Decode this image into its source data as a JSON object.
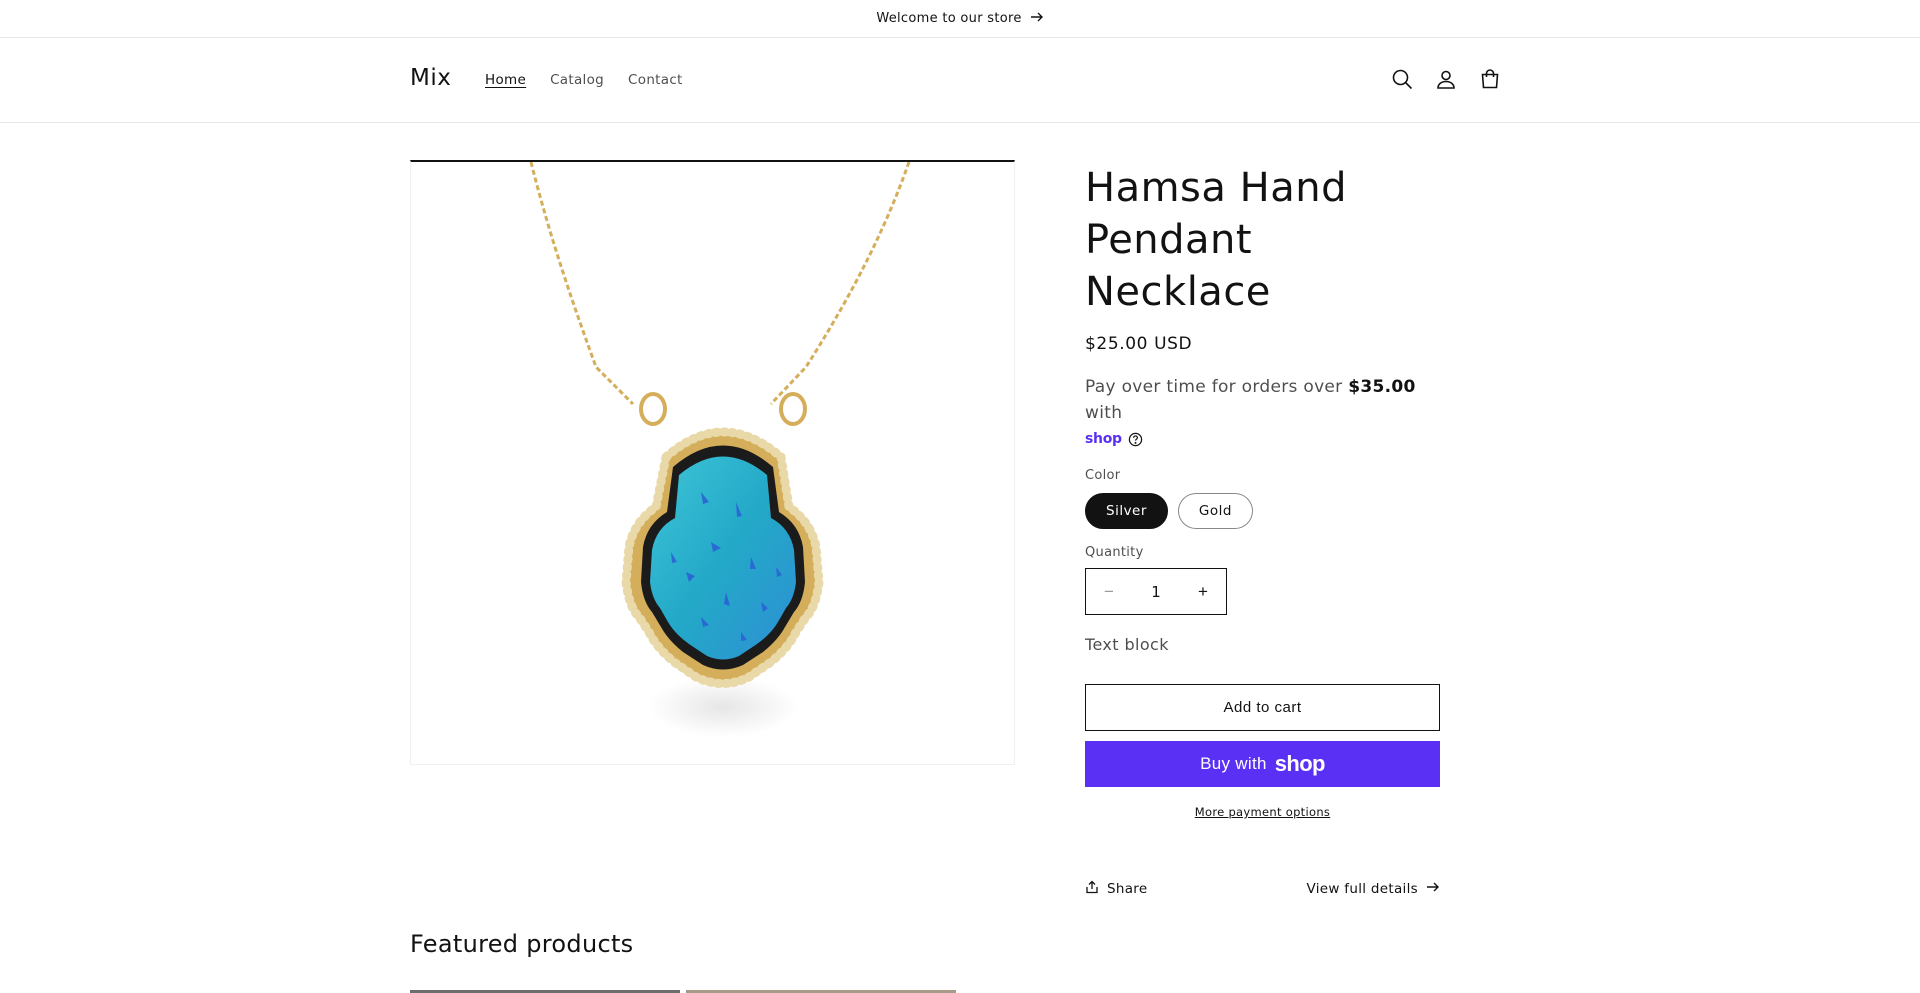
{
  "announcement": {
    "text": "Welcome to our store"
  },
  "header": {
    "logo": "Mix",
    "nav": [
      {
        "label": "Home"
      },
      {
        "label": "Catalog"
      },
      {
        "label": "Contact"
      }
    ],
    "icons": [
      "search-icon",
      "account-icon",
      "cart-icon"
    ]
  },
  "product": {
    "title": "Hamsa Hand Pendant Necklace",
    "price": "$25.00 USD",
    "installments": {
      "prefix": "Pay over time for orders over ",
      "amount": "$35.00",
      "suffix": " with",
      "brand": "shop"
    },
    "color_label": "Color",
    "colors": [
      {
        "label": "Silver",
        "selected": true
      },
      {
        "label": "Gold",
        "selected": false
      }
    ],
    "quantity_label": "Quantity",
    "quantity": "1",
    "text_block": "Text block",
    "add_to_cart": "Add to cart",
    "buy_with": "Buy with",
    "buy_brand": "shop",
    "more_payment": "More payment options",
    "share": "Share",
    "view_details": "View full details"
  },
  "featured": {
    "title": "Featured products"
  },
  "colors": {
    "shop_purple": "#5a31f4",
    "text": "#121212",
    "opal": "#2fb3c9",
    "gold": "#d4ae5a"
  }
}
